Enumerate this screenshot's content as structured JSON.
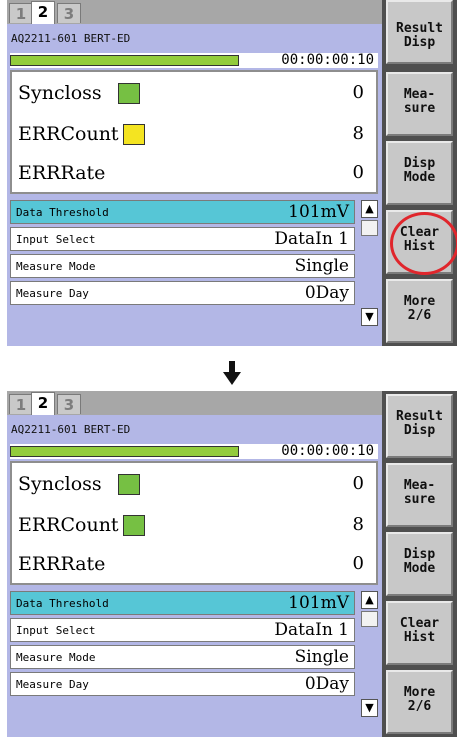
{
  "tabs": [
    "1",
    "2",
    "3"
  ],
  "model": "AQ2211-601 BERT-ED",
  "timer": "00:00:00:10",
  "progress": 1.0,
  "results_labels": [
    "Syncloss",
    "ERRCount",
    "ERRRate"
  ],
  "before": {
    "values": [
      "0",
      "8",
      "0"
    ],
    "indicator_colors": [
      "#76c043",
      "#f4e421"
    ]
  },
  "after": {
    "values": [
      "0",
      "8",
      "0"
    ],
    "indicator_colors": [
      "#76c043",
      "#76c043"
    ]
  },
  "params": [
    {
      "label": "Data Threshold",
      "value": "101mV"
    },
    {
      "label": "Input Select",
      "value": "DataIn 1"
    },
    {
      "label": "Measure Mode",
      "value": "Single"
    },
    {
      "label": "Measure Day",
      "value": "0Day"
    }
  ],
  "softkeys": [
    [
      "Result",
      "Disp"
    ],
    [
      "Mea-",
      "sure"
    ],
    [
      "Disp",
      "Mode"
    ],
    [
      "Clear",
      "Hist"
    ],
    [
      "More",
      "2/6"
    ]
  ],
  "highlight_color": "#e0262c",
  "arrow_icon": "arrow-down-icon"
}
